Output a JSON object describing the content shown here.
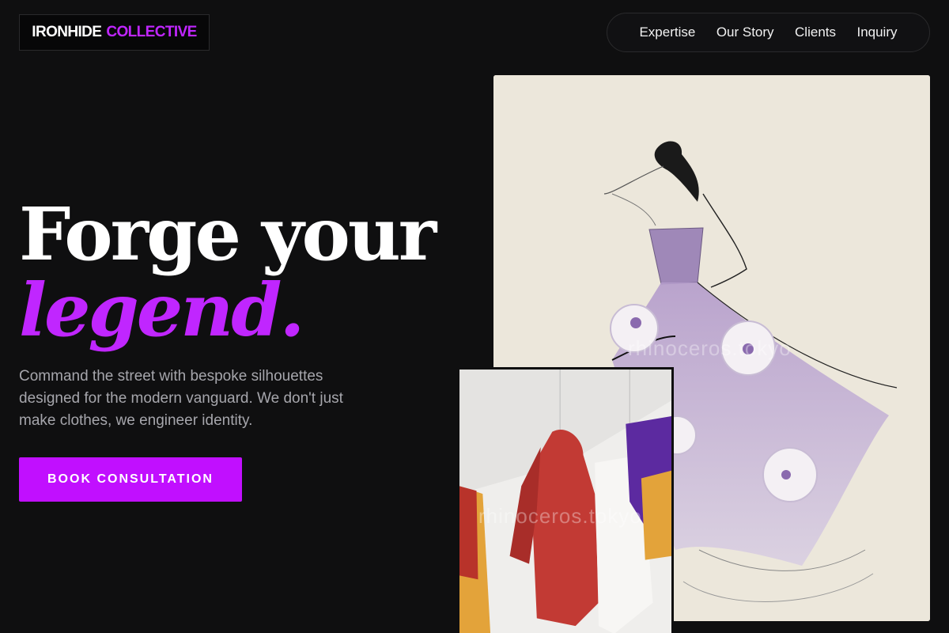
{
  "brand": {
    "name_primary": "IRONHIDE",
    "name_accent": "COLLECTIVE",
    "accent_color": "#c026ff"
  },
  "nav": {
    "items": [
      {
        "label": "Expertise"
      },
      {
        "label": "Our Story"
      },
      {
        "label": "Clients"
      },
      {
        "label": "Inquiry"
      }
    ]
  },
  "hero": {
    "headline_line1": "Forge your",
    "headline_line2": "legend.",
    "description": "Command the street with bespoke silhouettes designed for the modern vanguard. We don't just make clothes, we engineer identity.",
    "cta_label": "BOOK CONSULTATION",
    "cta_color": "#c10fff"
  },
  "images": {
    "sketch_watermark": "rhinoceros.tokyo",
    "photo_watermark": "rhinoceros.tokyo"
  }
}
